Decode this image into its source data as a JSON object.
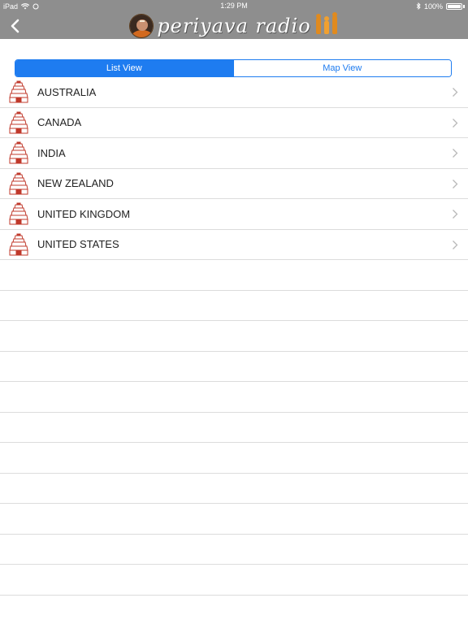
{
  "status_bar": {
    "device": "iPad",
    "time": "1:29 PM",
    "battery": "100%"
  },
  "nav": {
    "title": "periyava radio"
  },
  "segmented": {
    "list_view": "List View",
    "map_view": "Map View"
  },
  "countries": [
    {
      "label": "AUSTRALIA"
    },
    {
      "label": "CANADA"
    },
    {
      "label": "INDIA"
    },
    {
      "label": "NEW ZEALAND"
    },
    {
      "label": "UNITED KINGDOM"
    },
    {
      "label": "UNITED STATES"
    }
  ],
  "colors": {
    "bar_gray": "#8e8e8e",
    "accent_blue": "#1e7cf0",
    "temple_red": "#c0392b"
  }
}
